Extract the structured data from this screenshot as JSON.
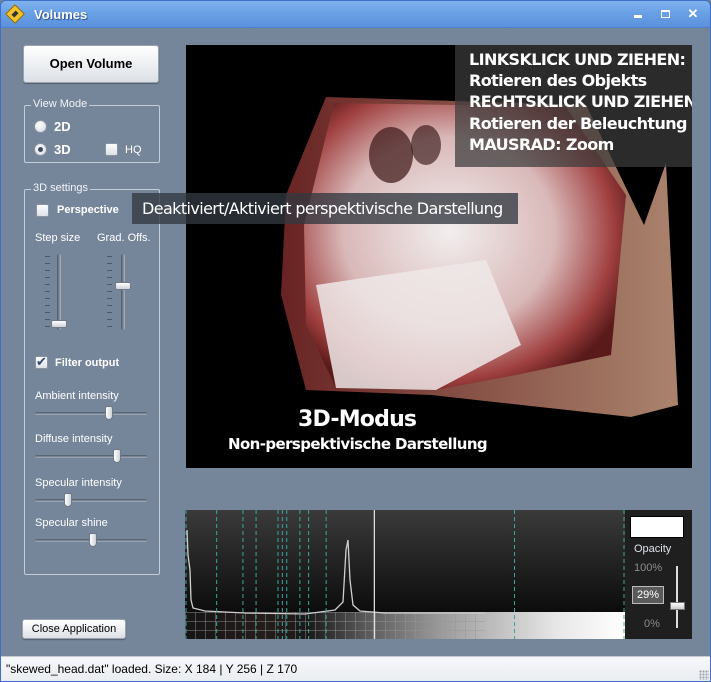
{
  "window": {
    "title": "Volumes",
    "controls": {
      "minimize": "minimize",
      "maximize": "maximize",
      "close": "✕"
    }
  },
  "sidebar": {
    "open_button": "Open Volume",
    "view_mode": {
      "label": "View Mode",
      "options": [
        {
          "label": "2D",
          "checked": false
        },
        {
          "label": "3D",
          "checked": true
        }
      ],
      "hq": {
        "label": "HQ",
        "checked": false
      }
    },
    "settings": {
      "label": "3D settings",
      "perspective": {
        "label": "Perspective",
        "checked": false
      },
      "step_size": {
        "label": "Step size",
        "value_fraction": 0.0
      },
      "grad_offs": {
        "label": "Grad. Offs.",
        "value_fraction": 0.6
      },
      "filter_output": {
        "label": "Filter output",
        "checked": true
      },
      "sliders": [
        {
          "label": "Ambient intensity",
          "value_fraction": 0.67
        },
        {
          "label": "Diffuse intensity",
          "value_fraction": 0.75
        },
        {
          "label": "Specular intensity",
          "value_fraction": 0.28
        },
        {
          "label": "Specular shine",
          "value_fraction": 0.52
        }
      ]
    },
    "close_button": "Close Application"
  },
  "viewport": {
    "hints": [
      "LINKSKLICK UND ZIEHEN:",
      "Rotieren des Objekts",
      "RECHTSKLICK UND ZIEHEN:",
      "Rotieren der Beleuchtung",
      "MAUSRAD: Zoom"
    ],
    "mode_title": "3D-Modus",
    "mode_subtitle": "Non-perspektivische Darstellung"
  },
  "tooltip": "Deaktiviert/Aktiviert perspektivische Darstellung",
  "transfer_function": {
    "marker_positions": [
      0.0,
      0.07,
      0.13,
      0.16,
      0.21,
      0.22,
      0.23,
      0.26,
      0.28,
      0.32,
      0.75,
      1.0
    ],
    "cursor_position": 0.43,
    "opacity": {
      "label": "Opacity",
      "max_label": "100%",
      "value": "29%",
      "min_label": "0%",
      "value_fraction": 0.29
    },
    "swatch_color": "#ffffff"
  },
  "status": {
    "text": "\"skewed_head.dat\" loaded. Size: X 184 | Y 256 | Z 170"
  }
}
